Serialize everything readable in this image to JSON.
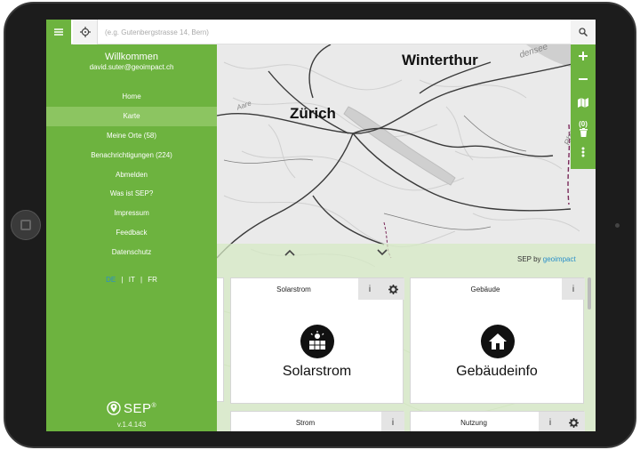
{
  "search": {
    "placeholder": "(e.g. Gutenbergstrasse 14, Bern)"
  },
  "map": {
    "labels": [
      "Winterthur",
      "Zürich",
      "densee",
      "Aare",
      "Rhe"
    ]
  },
  "map_controls": {
    "count": "(0)"
  },
  "sidebar": {
    "welcome": "Willkommen",
    "email": "david.suter@geoimpact.ch",
    "items": [
      {
        "label": "Home"
      },
      {
        "label": "Karte",
        "active": true
      },
      {
        "label": "Meine Orte (58)"
      },
      {
        "label": "Benachrichtigungen (224)"
      },
      {
        "label": "Abmelden"
      },
      {
        "label": "Was ist SEP?"
      },
      {
        "label": "Impressum"
      },
      {
        "label": "Feedback"
      },
      {
        "label": "Datenschutz"
      }
    ],
    "languages": [
      "DE",
      "IT",
      "FR"
    ],
    "lang_sep": "|",
    "logo_text": "SEP",
    "logo_reg": "®",
    "version": "v.1.4.143"
  },
  "panel": {
    "sep_by": "SEP by",
    "geoimpact": "geoimpact",
    "cards": [
      {
        "title": "Solarstrom",
        "label": "Solarstrom",
        "info": "i",
        "icon": "solar-panel-icon"
      },
      {
        "title": "Gebäude",
        "label": "Gebäudeinfo",
        "info": "i",
        "icon": "house-icon"
      },
      {
        "title": "Strom",
        "info": "i"
      },
      {
        "title": "Nutzung",
        "info": "i"
      }
    ]
  },
  "colors": {
    "brand_green": "#6db33f",
    "active_green": "#8cc561",
    "link_blue": "#2a8fc9"
  }
}
